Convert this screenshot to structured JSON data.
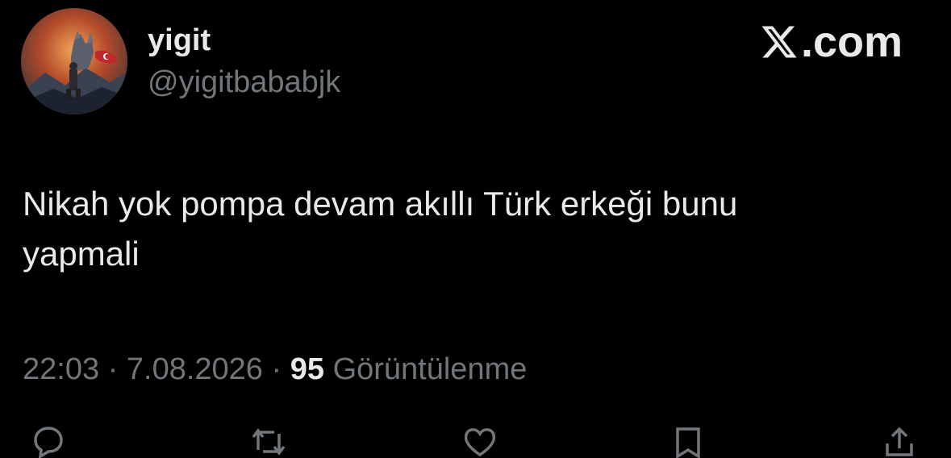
{
  "author": {
    "display_name": "yigit",
    "handle": "@yigitbababjk",
    "avatar_icon": "wolf-soldier-avatar"
  },
  "brand": {
    "logo_icon": "x-logo-icon",
    "label": ".com"
  },
  "tweet": {
    "text_line_1": "Nikah yok pompa devam akıllı Türk erkeği bunu",
    "text_line_2": "yapmali"
  },
  "meta": {
    "time": "22:03",
    "separator_1": "·",
    "date": "7.08.2026",
    "separator_2": "·",
    "views_count": "95",
    "views_label": "Görüntülenme"
  },
  "actions": [
    {
      "icon": "reply-icon"
    },
    {
      "icon": "retweet-icon"
    },
    {
      "icon": "like-icon"
    },
    {
      "icon": "bookmark-icon"
    },
    {
      "icon": "share-icon"
    }
  ],
  "colors": {
    "background": "#000000",
    "primary_text": "#e7e9ea",
    "secondary_text": "#71767b"
  }
}
